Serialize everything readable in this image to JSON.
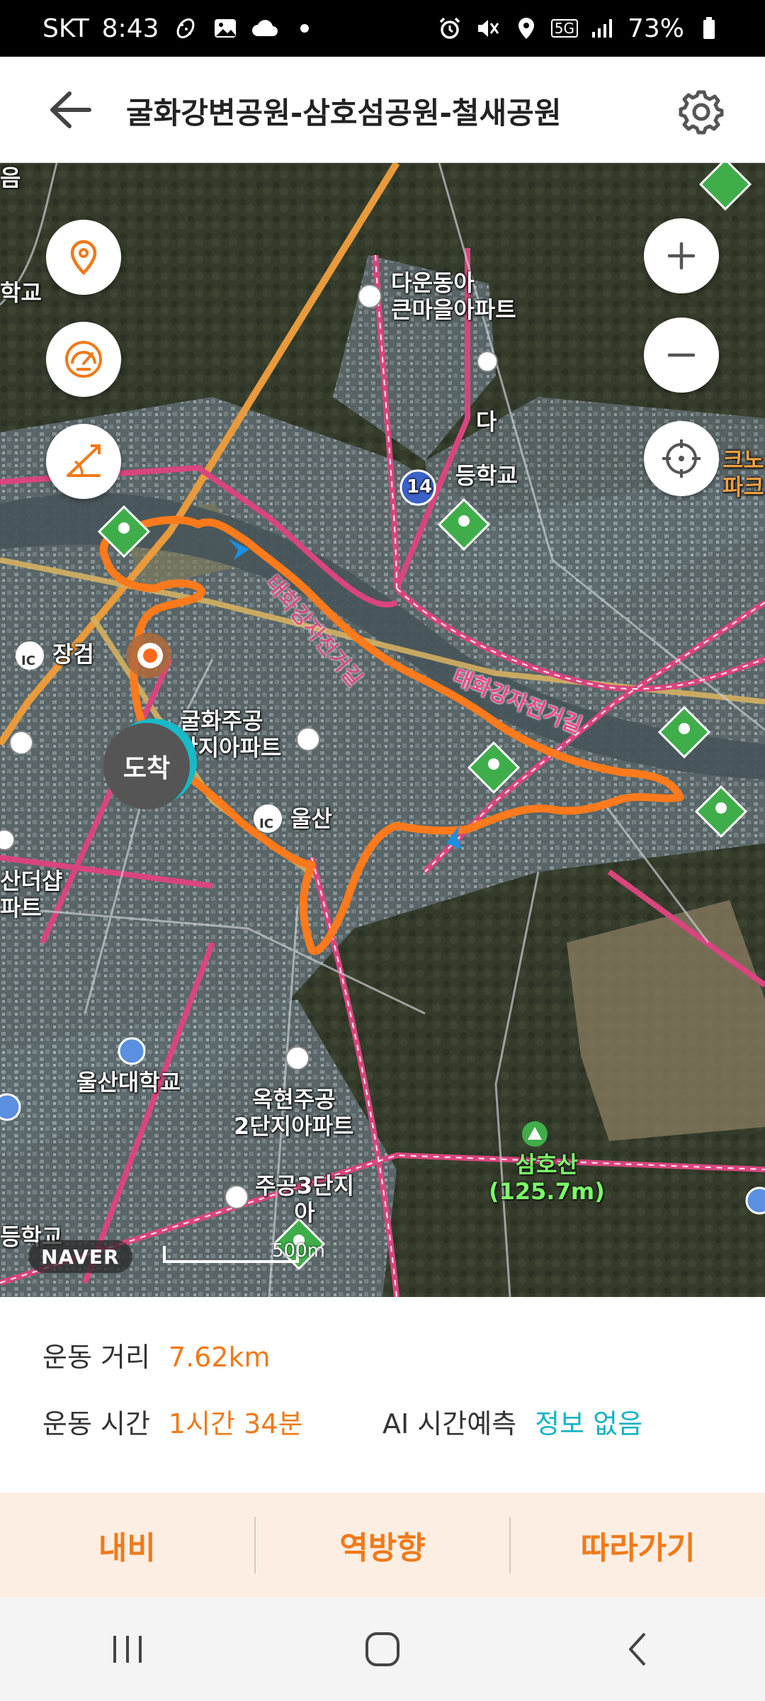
{
  "status_bar": {
    "carrier": "SKT",
    "time": "8:43",
    "network": "5G",
    "battery": "73%"
  },
  "header": {
    "title": "굴화강변공원-삼호섬공원-철새공원"
  },
  "map": {
    "labels": {
      "dawon_apt": "다운동아\n큰마을아파트",
      "school_top": "다",
      "school_top_suffix": "등학교",
      "route14": "14",
      "taehwa_road": "태화강자전거길",
      "bike_road_diag": "태화강자전거길",
      "jangeom": "장검",
      "gulhwa_apt": "굴화주공\n1단지아파트",
      "ulsan_ic": "울산",
      "ulsan_univ": "울산대학교",
      "okhyeon_apt": "옥현주공\n2단지아파트",
      "jugong3": "주공3단지\n아",
      "samho_mountain": "삼호산\n(125.7m)",
      "left_edge_1": "음",
      "left_edge_2": "학교",
      "left_edge_3": "산더샵\n파트",
      "left_edge_4": "등학교",
      "right_edge": "크노\n파크",
      "ic_badge": "IC",
      "arrive": "도착",
      "naver": "NAVER",
      "scale": "500m"
    },
    "icons": [
      "location-pin-icon",
      "speedometer-icon",
      "elevation-icon",
      "zoom-in-icon",
      "zoom-out-icon",
      "my-location-icon"
    ]
  },
  "info": {
    "distance_label": "운동 거리",
    "distance_value": "7.62km",
    "time_label": "운동 시간",
    "time_value": "1시간 34분",
    "ai_label": "AI 시간예측",
    "ai_value": "정보 없음"
  },
  "actions": {
    "navi": "내비",
    "reverse": "역방향",
    "follow": "따라가기"
  },
  "colors": {
    "accent": "#f07a1a",
    "teal": "#14b3c4",
    "route": "#ff7a1c",
    "road_pink": "#d9457e"
  }
}
